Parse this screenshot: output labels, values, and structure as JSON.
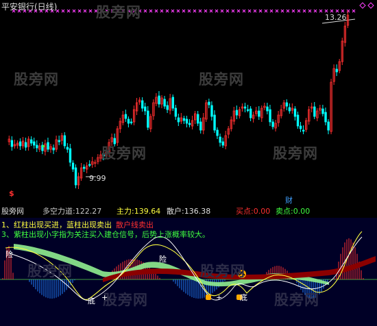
{
  "header": {
    "title": "平安银行(日线)"
  },
  "watermark": "股旁网",
  "price": {
    "high_label": "13.26",
    "low_label": "9.99",
    "event_marker": "$",
    "finance_marker": "财"
  },
  "indicator_bar": {
    "name": "股旁网",
    "items": [
      {
        "label": "多空力道:",
        "value": "122.27",
        "color": "#c8c8c8"
      },
      {
        "label": "主力:",
        "value": "139.64",
        "color": "#ffff40"
      },
      {
        "label": "散户:",
        "value": "136.38",
        "color": "#e0e0e0"
      },
      {
        "label": "买点:",
        "value": "0.00",
        "color": "#ff3030"
      },
      {
        "label": "卖点:",
        "value": "0.00",
        "color": "#40ff40"
      }
    ]
  },
  "notes": {
    "line1_main": "1、红柱出现买进，蓝柱出现卖出",
    "line1_tail": "散户线卖出",
    "line2": "3、紫柱出现小字指为关注买入建仓信号，后势上涨概率较大。"
  },
  "indicator_labels": {
    "risk1": "险",
    "risk2": "险",
    "bottom1": "底",
    "bottom2": "底",
    "jia": "+"
  },
  "colors": {
    "up": "#ff3030",
    "down": "#00ffff",
    "marker": "#ff40ff",
    "green_band": "#90ee90",
    "main_line": "#ffff40",
    "retail_line": "#ffffff"
  }
}
